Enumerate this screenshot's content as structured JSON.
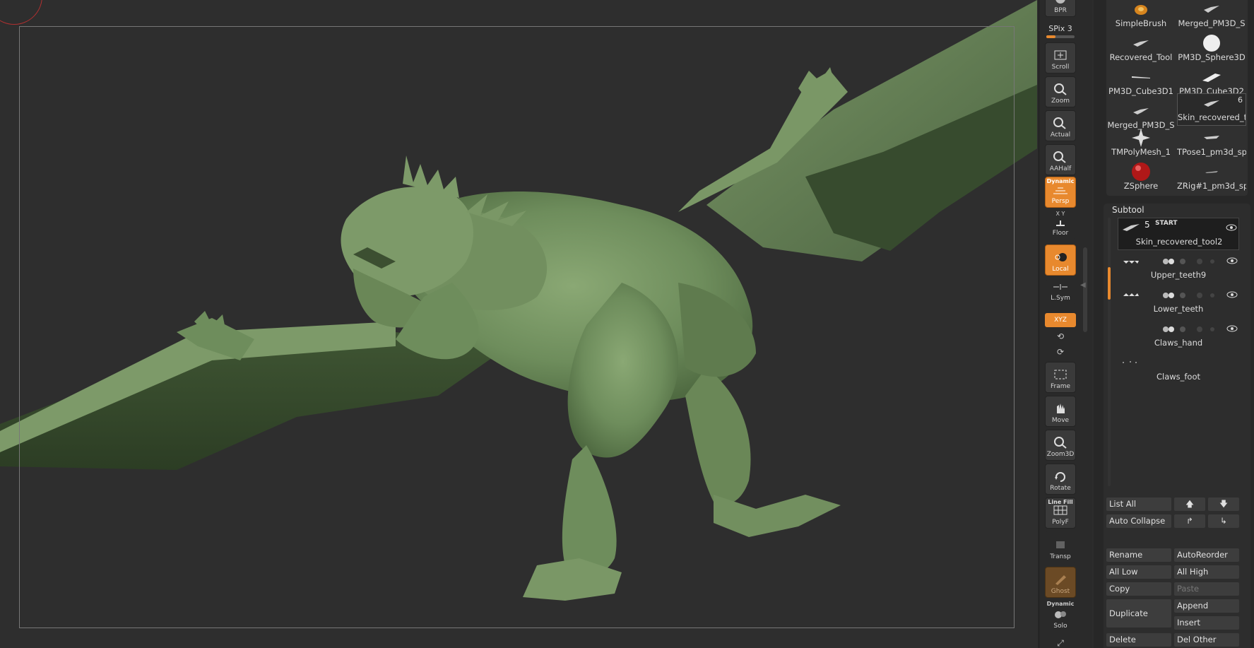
{
  "shelf": {
    "bpr_label": "BPR",
    "spix_label": "SPix 3",
    "spix_level": 0.33,
    "buttons": [
      {
        "label": "Scroll",
        "icon": "hand-scroll-icon"
      },
      {
        "label": "Zoom",
        "icon": "zoom-icon"
      },
      {
        "label": "Actual",
        "icon": "actual-icon"
      },
      {
        "label": "AAHalf",
        "icon": "aahalf-icon"
      },
      {
        "label": "Persp",
        "top": "Dynamic",
        "icon": "perspective-icon"
      },
      {
        "label": "Floor",
        "top": "X Y",
        "icon": "floor-icon"
      },
      {
        "label": "Local",
        "icon": "local-icon"
      },
      {
        "label": "L.Sym",
        "icon": "lsym-icon"
      },
      {
        "label": "XYZ",
        "icon": "xyz-icon"
      },
      {
        "label": "Frame",
        "icon": "frame-icon"
      },
      {
        "label": "Move",
        "icon": "move-icon"
      },
      {
        "label": "Zoom3D",
        "icon": "zoom3d-icon"
      },
      {
        "label": "Rotate",
        "icon": "rotate-icon"
      },
      {
        "label": "PolyF",
        "top": "Line Fill",
        "icon": "polyframe-icon"
      },
      {
        "label": "Transp",
        "icon": "transparency-icon"
      },
      {
        "label": "Ghost",
        "icon": "ghost-icon"
      },
      {
        "label": "Solo",
        "top": "Dynamic",
        "icon": "solo-icon"
      }
    ]
  },
  "tools": [
    {
      "name": "SimpleBrush",
      "icon": "simplebrush-icon"
    },
    {
      "name": "Merged_PM3D_S",
      "icon": "dragon-thumb-icon"
    },
    {
      "name": "Recovered_Tool",
      "icon": "dragon-thumb-icon"
    },
    {
      "name": "PM3D_Sphere3D",
      "icon": "sphere-icon"
    },
    {
      "name": "PM3D_Cube3D1",
      "icon": "blade-icon"
    },
    {
      "name": "PM3D_Cube3D2",
      "icon": "blade-icon"
    },
    {
      "name": "Merged_PM3D_S",
      "icon": "dragon-thumb-icon"
    },
    {
      "name": "Skin_recovered_t",
      "icon": "dragon-thumb-icon",
      "badge": "6"
    },
    {
      "name": "TMPolyMesh_1",
      "icon": "star-icon"
    },
    {
      "name": "TPose1_pm3d_sp",
      "icon": "dragon-thumb-icon"
    },
    {
      "name": "ZSphere",
      "icon": "zsphere-icon"
    },
    {
      "name": "ZRig#1_pm3d_sp",
      "icon": "dragon-thumb-icon"
    }
  ],
  "subtool": {
    "title": "Subtool",
    "items": [
      {
        "name": "Skin_recovered_tool2",
        "count": "5",
        "start": "START",
        "active": true
      },
      {
        "name": "Upper_teeth9",
        "active": false
      },
      {
        "name": "Lower_teeth",
        "active": false
      },
      {
        "name": "Claws_hand",
        "active": false
      },
      {
        "name": "Claws_foot",
        "active": false
      }
    ]
  },
  "buttons": {
    "list_all": "List All",
    "auto_collapse": "Auto Collapse",
    "rename": "Rename",
    "auto_reorder": "AutoReorder",
    "all_low": "All Low",
    "all_high": "All High",
    "copy": "Copy",
    "paste": "Paste",
    "duplicate": "Duplicate",
    "append": "Append",
    "insert": "Insert",
    "del_other": "Del Other",
    "delete": "Delete",
    "up_arrow": "🡅",
    "down_arrow": "🡇",
    "arrow_right_up": "↱",
    "arrow_right_down": "↳"
  },
  "colors": {
    "accent": "#e8892e",
    "model": "#6b8a5a",
    "background": "#2e2e2e"
  }
}
